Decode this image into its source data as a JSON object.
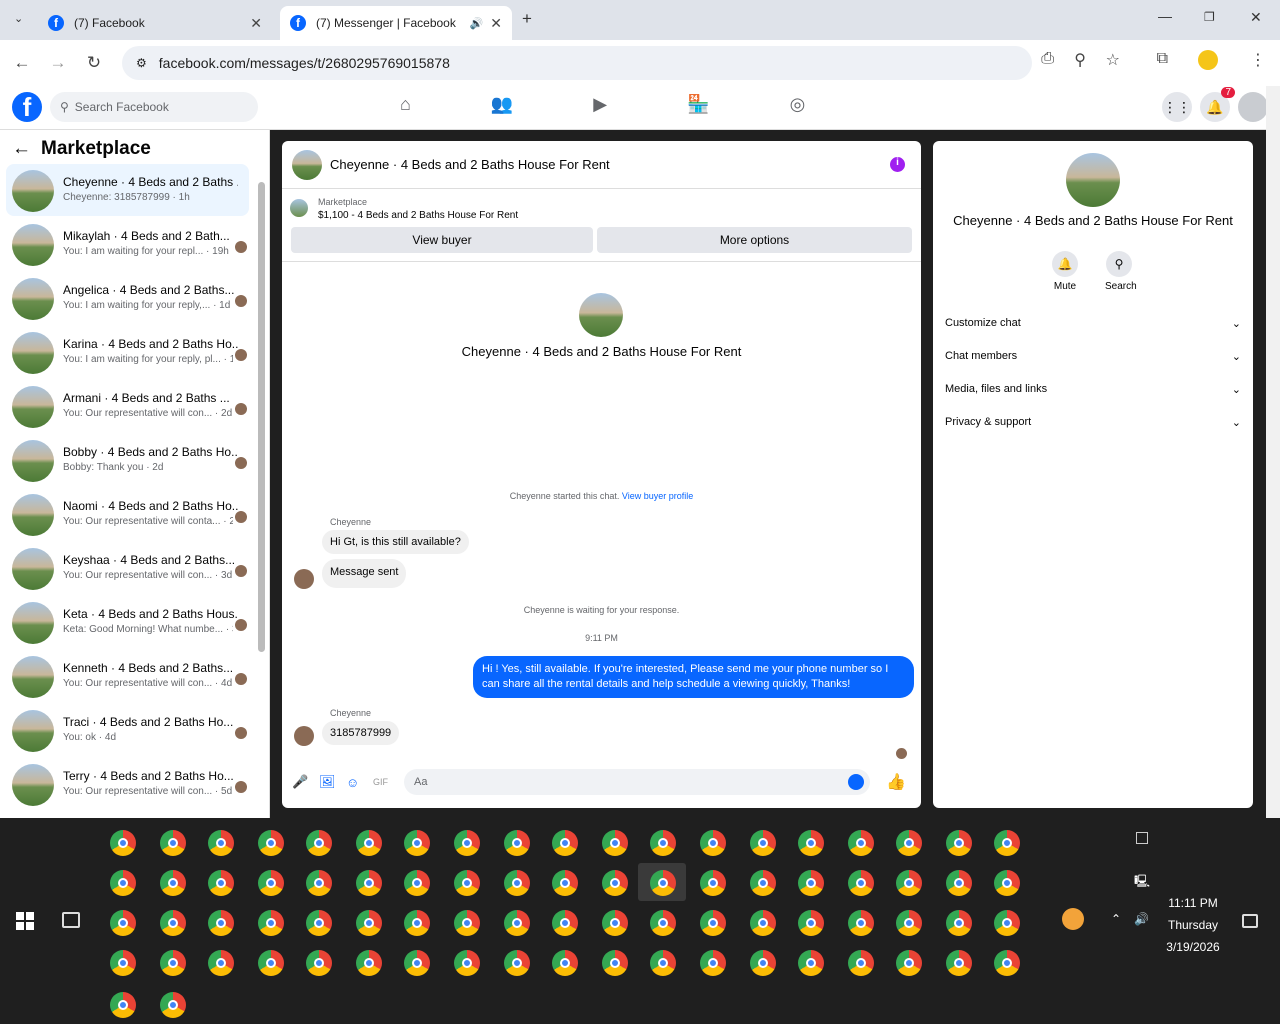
{
  "browser": {
    "tabs": [
      {
        "title": "(7) Facebook",
        "active": false
      },
      {
        "title": "(7) Messenger | Facebook",
        "active": true
      }
    ],
    "url": "facebook.com/messages/t/2680295769015878"
  },
  "fb_header": {
    "search_placeholder": "Search Facebook",
    "notification_count": "7"
  },
  "left": {
    "title": "Marketplace",
    "chats": [
      {
        "name": "Cheyenne · 4 Beds and 2 Baths ...",
        "snippet": "Cheyenne: 3185787999 · 1h",
        "active": true
      },
      {
        "name": "Mikaylah · 4 Beds and 2 Bath...",
        "snippet": "You: I am waiting for your repl... · 19h"
      },
      {
        "name": "Angelica · 4 Beds and 2 Baths...",
        "snippet": "You: I am waiting for your reply,... · 1d"
      },
      {
        "name": "Karina · 4 Beds and 2 Baths Ho...",
        "snippet": "You: I am waiting for your reply, pl... · 1d"
      },
      {
        "name": "Armani · 4 Beds and 2 Baths ...",
        "snippet": "You: Our representative will con... · 2d"
      },
      {
        "name": "Bobby · 4 Beds and 2 Baths Ho...",
        "snippet": "Bobby: Thank you · 2d"
      },
      {
        "name": "Naomi · 4 Beds and 2 Baths Ho...",
        "snippet": "You: Our representative will conta... · 2d"
      },
      {
        "name": "Keyshaa · 4 Beds and 2 Baths...",
        "snippet": "You: Our representative will con... · 3d"
      },
      {
        "name": "Keta · 4 Beds and 2 Baths Hous...",
        "snippet": "Keta: Good Morning! What numbe... · 3d"
      },
      {
        "name": "Kenneth · 4 Beds and 2 Baths...",
        "snippet": "You: Our representative will con... · 4d"
      },
      {
        "name": "Traci · 4 Beds and 2 Baths Ho...",
        "snippet": "You: ok · 4d"
      },
      {
        "name": "Terry · 4 Beds and 2 Baths Ho...",
        "snippet": "You: Our representative will con... · 5d"
      }
    ]
  },
  "chat": {
    "header_title": "Cheyenne · 4 Beds and 2 Baths House For Rent",
    "marketplace_label": "Marketplace",
    "listing": "$1,100 - 4 Beds and 2 Baths House For Rent",
    "view_buyer": "View buyer",
    "more_options": "More options",
    "center_title": "Cheyenne · 4 Beds and 2 Baths House For Rent",
    "started_text": "Cheyenne started this chat.",
    "view_profile_link": "View buyer profile",
    "sender_name": "Cheyenne",
    "msg1": "Hi Gt, is this still available?",
    "msg2": "Message sent",
    "waiting_text": "Cheyenne is waiting for your response.",
    "time": "9:11 PM",
    "outgoing": "Hi ! Yes, still available. If you're interested, Please send me your phone number so I can share all the rental details and help schedule a viewing quickly, Thanks!",
    "sender_name2": "Cheyenne",
    "msg3": "3185787999",
    "compose_placeholder": "Aa"
  },
  "right": {
    "title": "Cheyenne · 4 Beds and 2 Baths House For Rent",
    "mute": "Mute",
    "search": "Search",
    "sections": [
      "Customize chat",
      "Chat members",
      "Media, files and links",
      "Privacy & support"
    ]
  },
  "taskbar": {
    "time": "11:11 PM",
    "day": "Thursday",
    "date": "3/19/2026"
  }
}
